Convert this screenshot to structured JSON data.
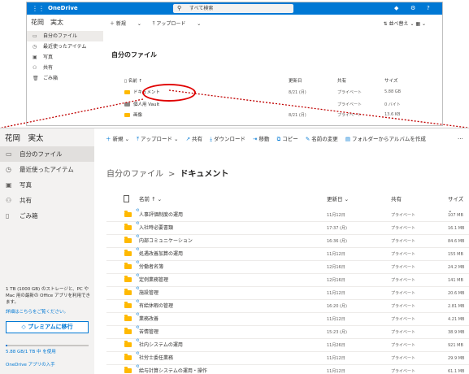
{
  "thumb": {
    "brand": "OneDrive",
    "search_placeholder": "すべて検索",
    "user": "花岡　実太",
    "nav": [
      "自分のファイル",
      "最近使ったアイテム",
      "写真",
      "共有",
      "ごみ箱"
    ],
    "cmd": [
      "新規",
      "アップロード"
    ],
    "sort_label": "並べ替え",
    "title": "自分のファイル",
    "headers": {
      "name": "名前 ↑",
      "modified": "更新日",
      "sharing": "共有",
      "size": "サイズ"
    },
    "rows": [
      {
        "name": "ドキュメント",
        "modified": "8/21 (月)",
        "sharing": "プライベート",
        "size": "5.88 GB"
      },
      {
        "name": "個人用 Vault",
        "modified": "",
        "sharing": "プライベート",
        "size": "0 バイト"
      },
      {
        "name": "画像",
        "modified": "8/21 (月)",
        "sharing": "プライベート",
        "size": "13.6 KB"
      }
    ]
  },
  "zoom": {
    "user": "花岡　実太",
    "nav": [
      {
        "label": "自分のファイル",
        "icon": "folder-icon"
      },
      {
        "label": "最近使ったアイテム",
        "icon": "clock-icon"
      },
      {
        "label": "写真",
        "icon": "photo-icon"
      },
      {
        "label": "共有",
        "icon": "share-icon"
      },
      {
        "label": "ごみ箱",
        "icon": "trash-icon"
      }
    ],
    "storage_text": "1 TB (1000 GB) のストレージと、PC や Mac 用の最新の Office アプリを利用できます。",
    "details_link": "詳細はこちらをご覧ください。",
    "premium_button": "プレミアムに移行",
    "usage_text": "5.88 GB/1 TB 中 を使用",
    "usage_fraction": 0.006,
    "app_link": "OneDrive アプリの入手",
    "toolbar": [
      "新規",
      "アップロード",
      "共有",
      "ダウンロード",
      "移動",
      "コピー",
      "名前の変更",
      "フォルダーからアルバムを作成"
    ],
    "more": "···",
    "breadcrumb_root": "自分のファイル",
    "breadcrumb_sep": ">",
    "breadcrumb_current": "ドキュメント",
    "headers": {
      "name": "名前 ↑",
      "modified": "更新日",
      "sharing": "共有",
      "size": "サイズ"
    },
    "rows": [
      {
        "name": "人事評価制度の運用",
        "modified": "11月12日",
        "sharing": "プライベート",
        "size": "107 MB"
      },
      {
        "name": "入社時必要書類",
        "modified": "17:37 (月)",
        "sharing": "プライベート",
        "size": "16.1 MB"
      },
      {
        "name": "内部コミュニケーション",
        "modified": "16:36 (月)",
        "sharing": "プライベート",
        "size": "84.6 MB"
      },
      {
        "name": "処遇改善加算の運用",
        "modified": "11月12日",
        "sharing": "プライベート",
        "size": "155 MB"
      },
      {
        "name": "労働者名簿",
        "modified": "12月16日",
        "sharing": "プライベート",
        "size": "24.2 MB"
      },
      {
        "name": "定例業務管理",
        "modified": "12月16日",
        "sharing": "プライベート",
        "size": "141 MB"
      },
      {
        "name": "施設管理",
        "modified": "11月12日",
        "sharing": "プライベート",
        "size": "20.6 MB"
      },
      {
        "name": "有給休暇の管理",
        "modified": "16:20 (月)",
        "sharing": "プライベート",
        "size": "2.81 MB"
      },
      {
        "name": "業務改善",
        "modified": "11月12日",
        "sharing": "プライベート",
        "size": "4.21 MB"
      },
      {
        "name": "苦情管理",
        "modified": "15:23 (月)",
        "sharing": "プライベート",
        "size": "38.9 MB"
      },
      {
        "name": "社内システムの運用",
        "modified": "11月26日",
        "sharing": "プライベート",
        "size": "921 MB"
      },
      {
        "name": "社労士委任業務",
        "modified": "11月12日",
        "sharing": "プライベート",
        "size": "29.9 MB"
      },
      {
        "name": "給与計算システムの運用・操作",
        "modified": "11月12日",
        "sharing": "プライベート",
        "size": "61.1 MB"
      }
    ]
  },
  "colors": {
    "accent": "#0078d4",
    "folder": "#ffb900",
    "highlight": "#e00000"
  }
}
